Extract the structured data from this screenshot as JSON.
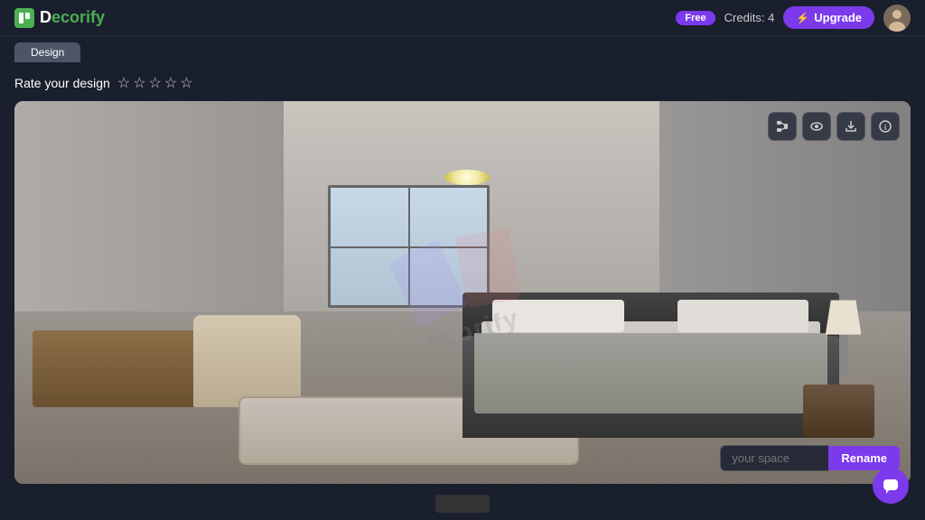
{
  "app": {
    "logo_text_d": "D",
    "logo_text_rest": "ecorify"
  },
  "header": {
    "badge_free": "Free",
    "credits_label": "Credits: 4",
    "upgrade_label": "Upgrade",
    "lightning_icon": "⚡"
  },
  "nav": {
    "tab_label": "Design"
  },
  "rating": {
    "label": "Rate your design",
    "stars": [
      "☆",
      "☆",
      "☆",
      "☆",
      "☆"
    ]
  },
  "toolbar": {
    "buttons": [
      {
        "icon": "⬆",
        "name": "share"
      },
      {
        "icon": "👁",
        "name": "view"
      },
      {
        "icon": "⬇",
        "name": "download"
      },
      {
        "icon": "ℹ",
        "name": "info"
      }
    ]
  },
  "rename": {
    "placeholder": "your space",
    "button_label": "Rename"
  },
  "chat": {
    "icon": "💬"
  },
  "watermark": {
    "text": "ecorify"
  }
}
